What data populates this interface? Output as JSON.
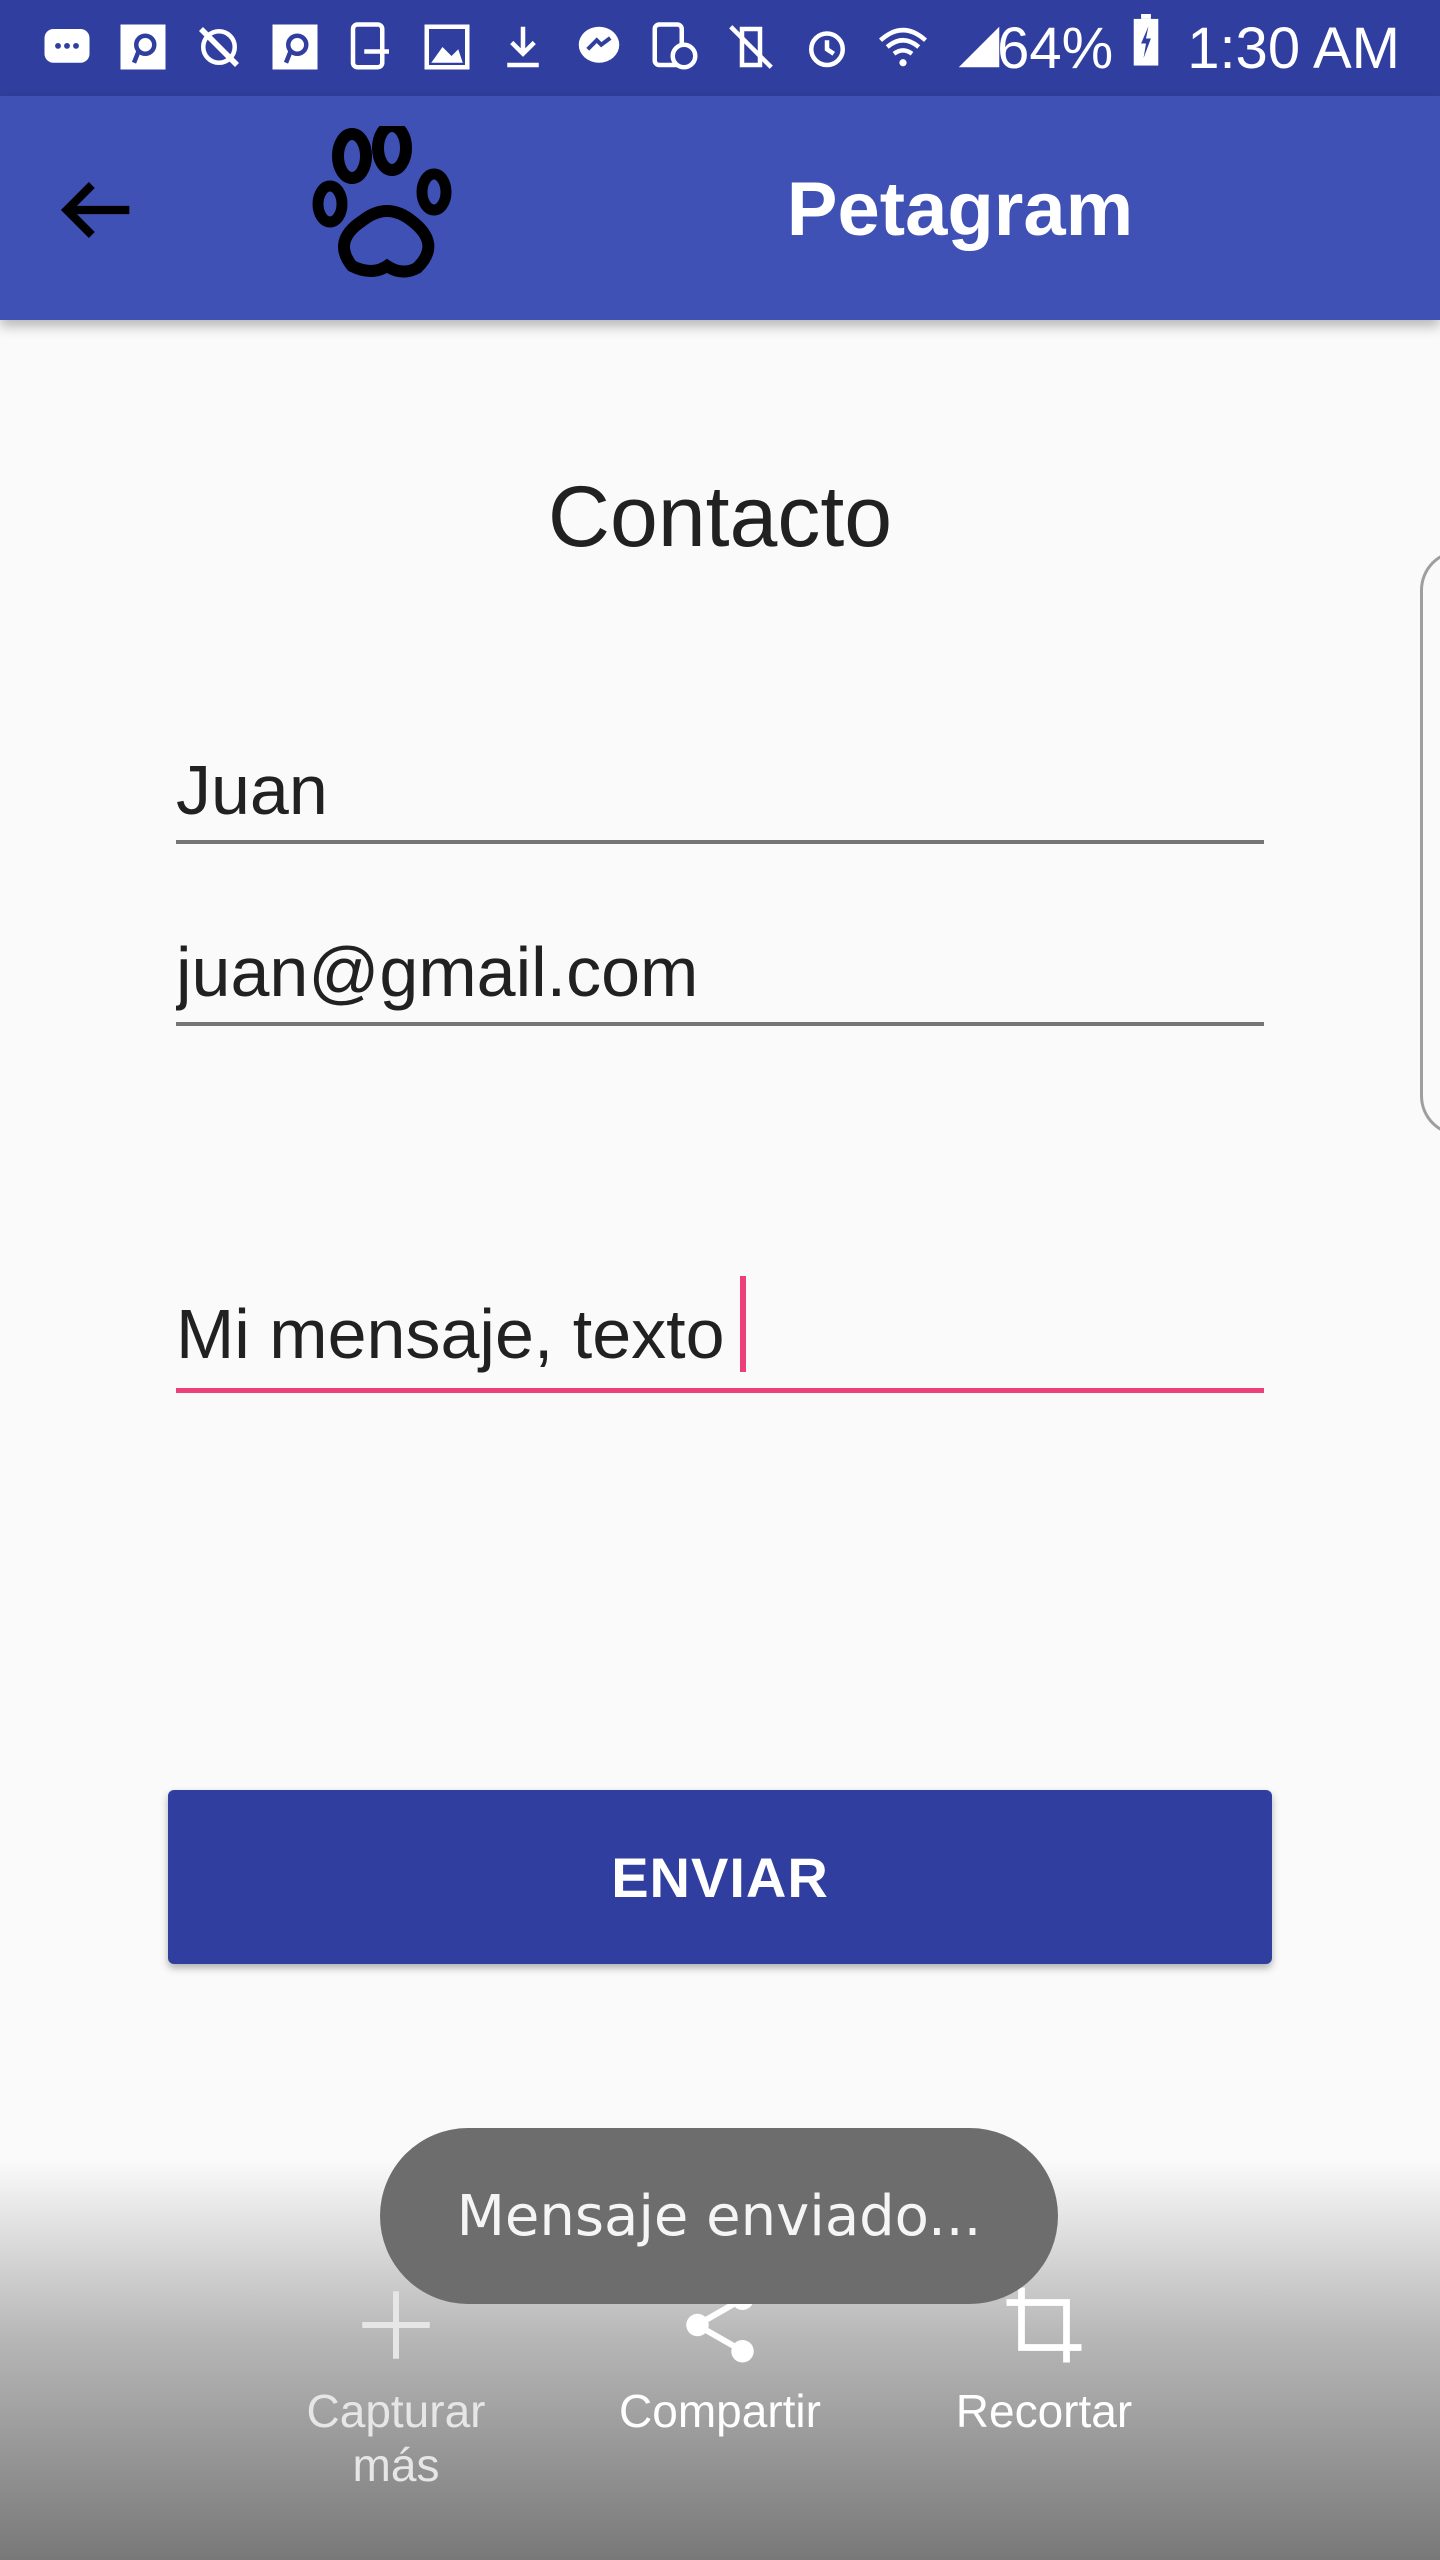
{
  "status_bar": {
    "battery_percent": "64%",
    "time": "1:30 AM",
    "icons": [
      "messages-icon",
      "p-app-icon",
      "tools-icon",
      "p-app-icon",
      "device-icon",
      "image-icon",
      "download-icon",
      "messenger-icon",
      "device-clock-icon",
      "vibrate-mute-icon",
      "alarm-icon",
      "wifi-icon",
      "signal-icon",
      "battery-charging-icon"
    ]
  },
  "toolbar": {
    "title": "Petagram",
    "back_icon": "arrow-left-icon",
    "logo_icon": "paw-icon"
  },
  "contact": {
    "title": "Contacto",
    "name_value": "Juan",
    "email_value": "juan@gmail.com",
    "message_value": "Mi mensaje, texto",
    "send_label": "ENVIAR"
  },
  "toast": {
    "text": "Mensaje enviado..."
  },
  "capture_toolbar": {
    "capture_more": "Capturar\nmás",
    "share": "Compartir",
    "crop": "Recortar"
  },
  "colors": {
    "status_bar": "#303f9f",
    "toolbar": "#3f51b5",
    "button": "#303f9f",
    "accent": "#ec407a"
  }
}
